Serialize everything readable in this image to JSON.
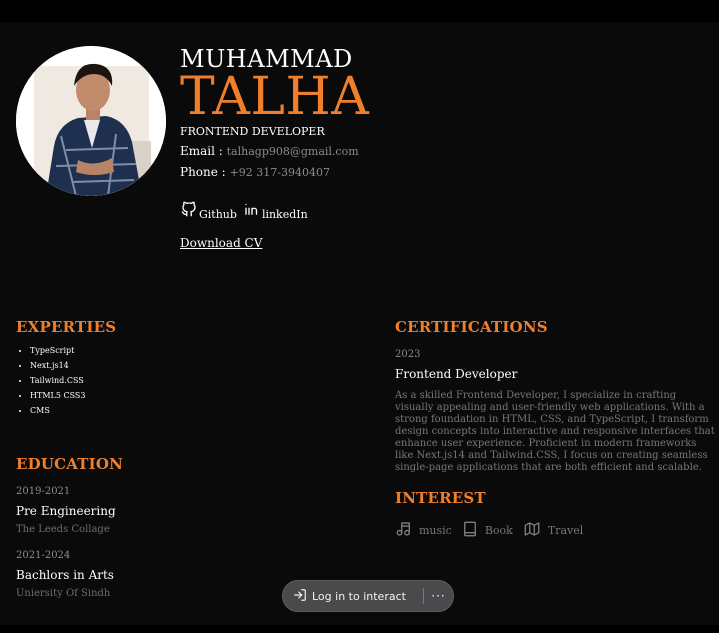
{
  "profile": {
    "first_name": "MUHAMMAD",
    "last_name": "TALHA",
    "role": "FRONTEND DEVELOPER",
    "email_label": "Email : ",
    "email": "talhagp908@gmail.com",
    "phone_label": "Phone : ",
    "phone": "+92 317-3940407",
    "github_label": "Github",
    "linkedin_label": "linkedIn",
    "download_label": "Download CV"
  },
  "expertise": {
    "title": "EXPERTIES",
    "items": [
      "TypeScript",
      "Next.js14",
      "Tailwind.CSS",
      "HTML5 CSS3",
      "CMS"
    ]
  },
  "education": {
    "title": "EDUCATION",
    "entries": [
      {
        "years": "2019-2021",
        "degree": "Pre Engineering",
        "school": "The Leeds Collage"
      },
      {
        "years": "2021-2024",
        "degree": "Bachlors in Arts",
        "school": "Uniersity Of Sindh"
      }
    ]
  },
  "certifications": {
    "title": "CERTIFICATIONS",
    "year": "2023",
    "name": "Frontend Developer",
    "description": "As a skilled Frontend Developer, I specialize in crafting visually appealing and user-friendly web applications. With a strong foundation in HTML, CSS, and TypeScript, I transform design concepts into interactive and responsive interfaces that enhance user experience. Proficient in modern frameworks like Next.js14 and Tailwind.CSS, I focus on creating seamless single-page applications that are both efficient and scalable."
  },
  "interest": {
    "title": "INTEREST",
    "items": [
      {
        "label": "music",
        "icon": "music-icon"
      },
      {
        "label": "Book",
        "icon": "book-icon"
      },
      {
        "label": "Travel",
        "icon": "map-icon"
      }
    ]
  },
  "overlay": {
    "login_label": "Log in to interact",
    "more_label": "···"
  },
  "colors": {
    "accent": "#f07f2c",
    "background": "#0a0a0b",
    "muted_text": "#8c8c8c"
  }
}
